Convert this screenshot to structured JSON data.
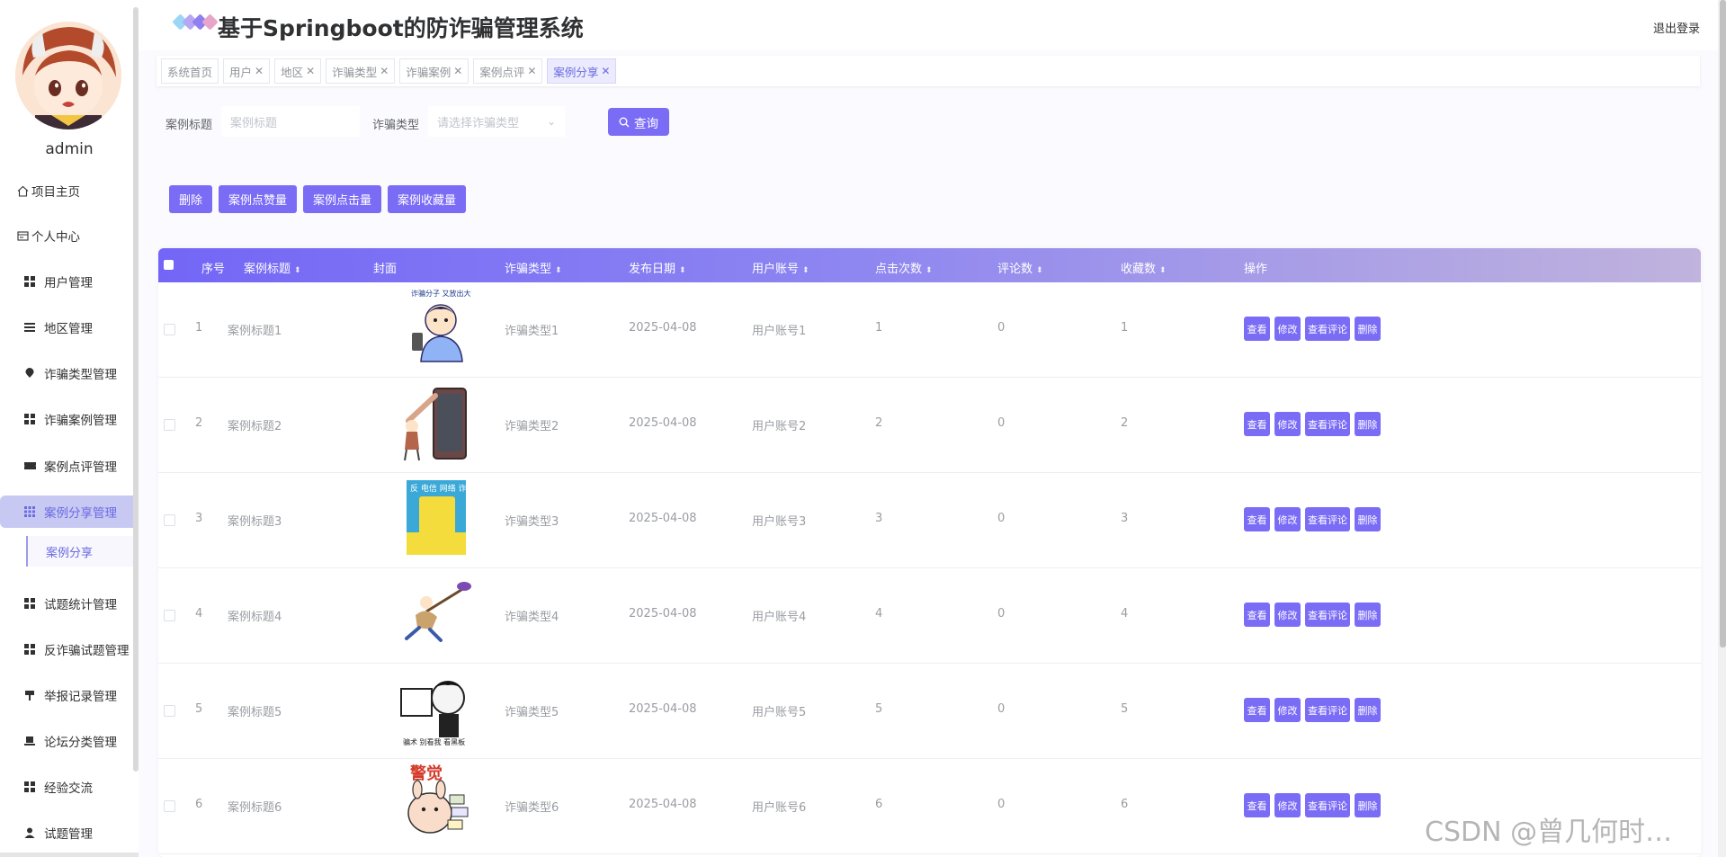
{
  "header": {
    "title": "基于Springboot的防诈骗管理系统",
    "logout": "退出登录",
    "logo_colors": [
      "#9bd6f5",
      "#b7a6f3",
      "#8f7ff0",
      "#e7a6c9"
    ]
  },
  "sidebar": {
    "username": "admin",
    "items": [
      {
        "label": "项目主页",
        "icon": "home-icon"
      },
      {
        "label": "个人中心",
        "icon": "profile-card-icon"
      },
      {
        "label": "用户管理",
        "icon": "grid-icon"
      },
      {
        "label": "地区管理",
        "icon": "list-icon"
      },
      {
        "label": "诈骗类型管理",
        "icon": "location-pin-icon"
      },
      {
        "label": "诈骗案例管理",
        "icon": "grid-icon"
      },
      {
        "label": "案例点评管理",
        "icon": "ticket-icon"
      },
      {
        "label": "案例分享管理",
        "icon": "apps-icon"
      },
      {
        "label": "试题统计管理",
        "icon": "grid-icon"
      },
      {
        "label": "反诈骗试题管理",
        "icon": "grid-icon"
      },
      {
        "label": "举报记录管理",
        "icon": "flag-icon"
      },
      {
        "label": "论坛分类管理",
        "icon": "laptop-icon"
      },
      {
        "label": "经验交流",
        "icon": "grid-icon"
      },
      {
        "label": "试题管理",
        "icon": "user-icon"
      }
    ],
    "submenu": {
      "label": "案例分享"
    }
  },
  "tabs": [
    {
      "label": "系统首页",
      "closable": false
    },
    {
      "label": "用户",
      "closable": true
    },
    {
      "label": "地区",
      "closable": true
    },
    {
      "label": "诈骗类型",
      "closable": true
    },
    {
      "label": "诈骗案例",
      "closable": true
    },
    {
      "label": "案例点评",
      "closable": true
    },
    {
      "label": "案例分享",
      "closable": true,
      "active": true
    }
  ],
  "search": {
    "title_label": "案例标题",
    "title_placeholder": "案例标题",
    "type_label": "诈骗类型",
    "type_placeholder": "请选择诈骗类型",
    "query_button": "查询"
  },
  "actions": [
    "删除",
    "案例点赞量",
    "案例点击量",
    "案例收藏量"
  ],
  "table": {
    "columns": [
      "序号",
      "案例标题",
      "封面",
      "诈骗类型",
      "发布日期",
      "用户账号",
      "点击次数",
      "评论数",
      "收藏数",
      "操作"
    ],
    "row_buttons": [
      "查看",
      "修改",
      "查看评论",
      "删除"
    ],
    "rows": [
      {
        "index": "1",
        "title": "案例标题1",
        "type": "诈骗类型1",
        "date": "2025-04-08",
        "account": "用户账号1",
        "clicks": "1",
        "comments": "0",
        "favorites": "1",
        "cover_text": "诈骗分子 又放出大招了"
      },
      {
        "index": "2",
        "title": "案例标题2",
        "type": "诈骗类型2",
        "date": "2025-04-08",
        "account": "用户账号2",
        "clicks": "2",
        "comments": "0",
        "favorites": "2",
        "cover_text": ""
      },
      {
        "index": "3",
        "title": "案例标题3",
        "type": "诈骗类型3",
        "date": "2025-04-08",
        "account": "用户账号3",
        "clicks": "3",
        "comments": "0",
        "favorites": "3",
        "cover_text": "反 电信 网络 诈骗"
      },
      {
        "index": "4",
        "title": "案例标题4",
        "type": "诈骗类型4",
        "date": "2025-04-08",
        "account": "用户账号4",
        "clicks": "4",
        "comments": "0",
        "favorites": "4",
        "cover_text": ""
      },
      {
        "index": "5",
        "title": "案例标题5",
        "type": "诈骗类型5",
        "date": "2025-04-08",
        "account": "用户账号5",
        "clicks": "5",
        "comments": "0",
        "favorites": "5",
        "cover_text": "骗术 别看我 看黑板"
      },
      {
        "index": "6",
        "title": "案例标题6",
        "type": "诈骗类型6",
        "date": "2025-04-08",
        "account": "用户账号6",
        "clicks": "6",
        "comments": "0",
        "favorites": "6",
        "cover_text": "警觉"
      }
    ]
  },
  "watermark": "CSDN @曾几何时…"
}
